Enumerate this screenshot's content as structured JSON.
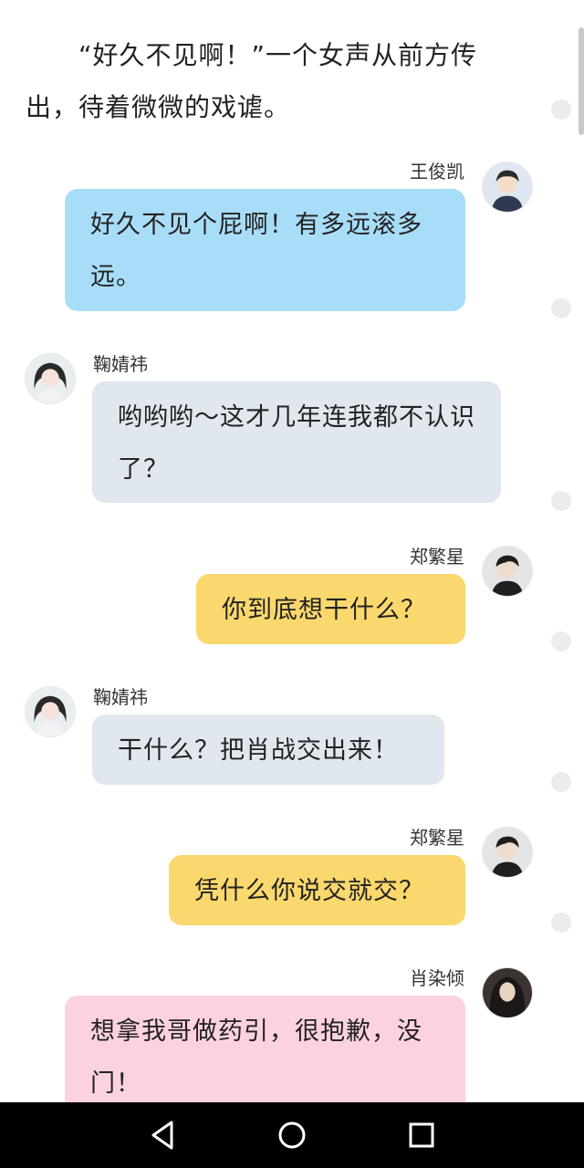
{
  "narration": "“好久不见啊！”一个女声从前方传出，待着微微的戏谑。",
  "messages": [
    {
      "speaker": "王俊凯",
      "text": "好久不见个屁啊！有多远滚多远。",
      "avatar": "avatar-wangjunkai"
    },
    {
      "speaker": "鞠婧祎",
      "text": "哟哟哟～这才几年连我都不认识了？",
      "avatar": "avatar-jujingyi"
    },
    {
      "speaker": "郑繁星",
      "text": "你到底想干什么？",
      "avatar": "avatar-zhengfanxing"
    },
    {
      "speaker": "鞠婧祎",
      "text": "干什么？把肖战交出来！",
      "avatar": "avatar-jujingyi"
    },
    {
      "speaker": "郑繁星",
      "text": "凭什么你说交就交？",
      "avatar": "avatar-zhengfanxing"
    },
    {
      "speaker": "肖染倾",
      "text": "想拿我哥做药引，很抱歉，没门！",
      "avatar": "avatar-xiaoranqing"
    }
  ],
  "colors": {
    "bubble_blue": "#a8ddf8",
    "bubble_gray": "#e1e7ee",
    "bubble_yellow": "#fbd86d",
    "bubble_pink": "#fcd2de",
    "nav_bar": "#000000"
  },
  "navbar": {
    "back_icon": "back-triangle-icon",
    "home_icon": "home-circle-icon",
    "recents_icon": "recents-square-icon"
  }
}
